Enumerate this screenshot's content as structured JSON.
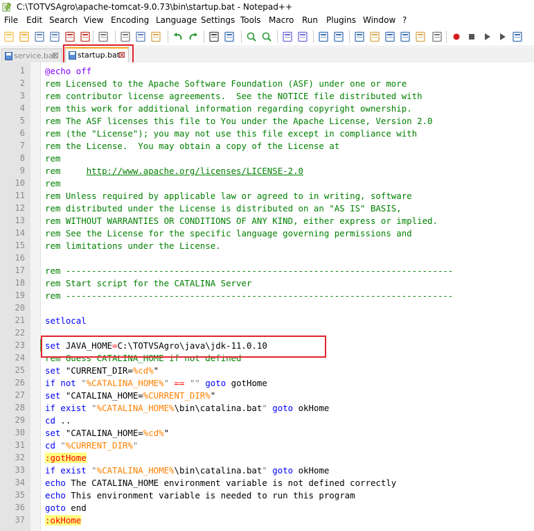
{
  "window": {
    "title": "C:\\TOTVSAgro\\apache-tomcat-9.0.73\\bin\\startup.bat - Notepad++"
  },
  "menu": [
    "File",
    "Edit",
    "Search",
    "View",
    "Encoding",
    "Language",
    "Settings",
    "Tools",
    "Macro",
    "Run",
    "Plugins",
    "Window",
    "?"
  ],
  "toolbar": [
    "new-file-icon",
    "open-file-icon",
    "save-icon",
    "save-all-icon",
    "close-icon",
    "close-all-icon",
    "print-icon",
    "cut-icon",
    "copy-icon",
    "paste-icon",
    "undo-icon",
    "redo-icon",
    "find-icon",
    "replace-icon",
    "zoom-in-icon",
    "zoom-out-icon",
    "sync-vertical-icon",
    "sync-horizontal-icon",
    "word-wrap-icon",
    "show-all-chars-icon",
    "indent-guide-icon",
    "udl-icon",
    "doc-map-icon",
    "function-list-icon",
    "folder-workspace-icon",
    "monitoring-icon",
    "record-macro-icon",
    "stop-macro-icon",
    "play-macro-icon",
    "run-macro-multiple-icon",
    "save-macro-icon"
  ],
  "tabs": [
    {
      "label": "service.bat",
      "active": false
    },
    {
      "label": "startup.bat",
      "active": true
    }
  ],
  "lines": [
    {
      "n": "1",
      "t": [
        [
          "echo",
          "@echo off"
        ]
      ]
    },
    {
      "n": "2",
      "t": [
        [
          "c",
          "rem Licensed to the Apache Software Foundation (ASF) under one or more"
        ]
      ]
    },
    {
      "n": "3",
      "t": [
        [
          "c",
          "rem contributor license agreements.  See the NOTICE file distributed with"
        ]
      ]
    },
    {
      "n": "4",
      "t": [
        [
          "c",
          "rem this work for additional information regarding copyright ownership."
        ]
      ]
    },
    {
      "n": "5",
      "t": [
        [
          "c",
          "rem The ASF licenses this file to You under the Apache License, Version 2.0"
        ]
      ]
    },
    {
      "n": "6",
      "t": [
        [
          "c",
          "rem (the \"License\"); you may not use this file except in compliance with"
        ]
      ]
    },
    {
      "n": "7",
      "t": [
        [
          "c",
          "rem the License.  You may obtain a copy of the License at"
        ]
      ]
    },
    {
      "n": "8",
      "t": [
        [
          "c",
          "rem"
        ]
      ]
    },
    {
      "n": "9",
      "t": [
        [
          "c",
          "rem     "
        ],
        [
          "link",
          "http://www.apache.org/licenses/LICENSE-2.0"
        ]
      ]
    },
    {
      "n": "10",
      "t": [
        [
          "c",
          "rem"
        ]
      ]
    },
    {
      "n": "11",
      "t": [
        [
          "c",
          "rem Unless required by applicable law or agreed to in writing, software"
        ]
      ]
    },
    {
      "n": "12",
      "t": [
        [
          "c",
          "rem distributed under the License is distributed on an \"AS IS\" BASIS,"
        ]
      ]
    },
    {
      "n": "13",
      "t": [
        [
          "c",
          "rem WITHOUT WARRANTIES OR CONDITIONS OF ANY KIND, either express or implied."
        ]
      ]
    },
    {
      "n": "14",
      "t": [
        [
          "c",
          "rem See the License for the specific language governing permissions and"
        ]
      ]
    },
    {
      "n": "15",
      "t": [
        [
          "c",
          "rem limitations under the License."
        ]
      ]
    },
    {
      "n": "16",
      "t": []
    },
    {
      "n": "17",
      "t": [
        [
          "c",
          "rem ---------------------------------------------------------------------------"
        ]
      ]
    },
    {
      "n": "18",
      "t": [
        [
          "c",
          "rem Start script for the CATALINA Server"
        ]
      ]
    },
    {
      "n": "19",
      "t": [
        [
          "c",
          "rem ---------------------------------------------------------------------------"
        ]
      ]
    },
    {
      "n": "20",
      "t": []
    },
    {
      "n": "21",
      "t": [
        [
          "kw",
          "setlocal"
        ]
      ]
    },
    {
      "n": "22",
      "t": []
    },
    {
      "n": "23",
      "t": [
        [
          "kw",
          "set"
        ],
        [
          "p",
          " JAVA_HOME"
        ],
        [
          "op",
          "="
        ],
        [
          "p",
          "C:\\TOTVSAgro\\java\\jdk-11.0.10"
        ]
      ]
    },
    {
      "n": "24",
      "t": [
        [
          "c",
          "rem Guess CATALINA_HOME if not defined"
        ]
      ]
    },
    {
      "n": "25",
      "t": [
        [
          "kw",
          "set"
        ],
        [
          "p",
          " \"CURRENT_DIR="
        ],
        [
          "var",
          "%cd%"
        ],
        [
          "p",
          "\""
        ]
      ]
    },
    {
      "n": "26",
      "t": [
        [
          "kw",
          "if not"
        ],
        [
          "p",
          " "
        ],
        [
          "str",
          "\""
        ],
        [
          "var",
          "%CATALINA_HOME%"
        ],
        [
          "str",
          "\""
        ],
        [
          "p",
          " "
        ],
        [
          "op",
          "=="
        ],
        [
          "p",
          " "
        ],
        [
          "str",
          "\"\""
        ],
        [
          "p",
          " "
        ],
        [
          "kw",
          "goto"
        ],
        [
          "p",
          " gotHome"
        ]
      ]
    },
    {
      "n": "27",
      "t": [
        [
          "kw",
          "set"
        ],
        [
          "p",
          " \"CATALINA_HOME="
        ],
        [
          "var",
          "%CURRENT_DIR%"
        ],
        [
          "p",
          "\""
        ]
      ]
    },
    {
      "n": "28",
      "t": [
        [
          "kw",
          "if exist"
        ],
        [
          "p",
          " "
        ],
        [
          "str",
          "\""
        ],
        [
          "var",
          "%CATALINA_HOME%"
        ],
        [
          "p",
          "\\bin\\catalina.bat"
        ],
        [
          "str",
          "\""
        ],
        [
          "p",
          " "
        ],
        [
          "kw",
          "goto"
        ],
        [
          "p",
          " okHome"
        ]
      ]
    },
    {
      "n": "29",
      "t": [
        [
          "kw",
          "cd"
        ],
        [
          "p",
          " .."
        ]
      ]
    },
    {
      "n": "30",
      "t": [
        [
          "kw",
          "set"
        ],
        [
          "p",
          " \"CATALINA_HOME="
        ],
        [
          "var",
          "%cd%"
        ],
        [
          "p",
          "\""
        ]
      ]
    },
    {
      "n": "31",
      "t": [
        [
          "kw",
          "cd"
        ],
        [
          "p",
          " "
        ],
        [
          "str",
          "\""
        ],
        [
          "var",
          "%CURRENT_DIR%"
        ],
        [
          "str",
          "\""
        ]
      ]
    },
    {
      "n": "32",
      "t": [
        [
          "label",
          ":gotHome"
        ]
      ]
    },
    {
      "n": "33",
      "t": [
        [
          "kw",
          "if exist"
        ],
        [
          "p",
          " "
        ],
        [
          "str",
          "\""
        ],
        [
          "var",
          "%CATALINA_HOME%"
        ],
        [
          "p",
          "\\bin\\catalina.bat"
        ],
        [
          "str",
          "\""
        ],
        [
          "p",
          " "
        ],
        [
          "kw",
          "goto"
        ],
        [
          "p",
          " okHome"
        ]
      ]
    },
    {
      "n": "34",
      "t": [
        [
          "kw",
          "echo"
        ],
        [
          "p",
          " The CATALINA_HOME environment variable is not defined correctly"
        ]
      ]
    },
    {
      "n": "35",
      "t": [
        [
          "kw",
          "echo"
        ],
        [
          "p",
          " This environment variable is needed to run this program"
        ]
      ]
    },
    {
      "n": "36",
      "t": [
        [
          "kw",
          "goto"
        ],
        [
          "p",
          " end"
        ]
      ]
    },
    {
      "n": "37",
      "t": [
        [
          "label",
          ":okHome"
        ]
      ]
    }
  ]
}
